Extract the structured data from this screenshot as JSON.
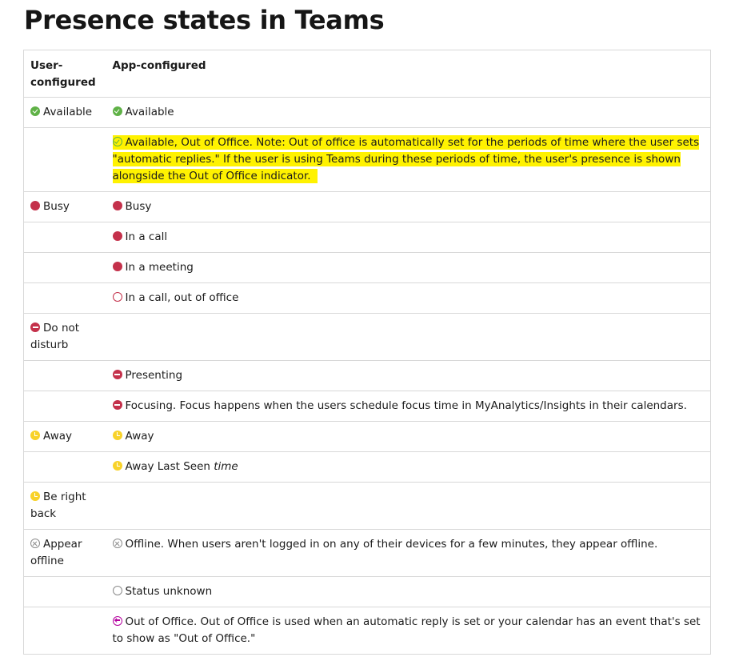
{
  "page_title": "Presence states in Teams",
  "headers": {
    "col1": "User-configured",
    "col2": "App-configured"
  },
  "rows": [
    {
      "user": {
        "icon": "available-icon",
        "text": "Available"
      },
      "app": {
        "icon": "available-icon",
        "text": "Available"
      }
    },
    {
      "user": null,
      "app": {
        "icon": "available-out-of-office-icon",
        "text": "Available, Out of Office. Note: Out of office is automatically set for the periods of time where the user sets \"automatic replies.\" If the user is using Teams during these periods of time, the user's presence is shown alongside the Out of Office indicator.",
        "highlighted": true
      }
    },
    {
      "user": {
        "icon": "busy-icon",
        "text": "Busy"
      },
      "app": {
        "icon": "busy-icon",
        "text": "Busy"
      }
    },
    {
      "user": null,
      "app": {
        "icon": "busy-icon",
        "text": "In a call"
      }
    },
    {
      "user": null,
      "app": {
        "icon": "busy-icon",
        "text": "In a meeting"
      }
    },
    {
      "user": null,
      "app": {
        "icon": "busy-out-of-office-icon",
        "text": "In a call, out of office"
      }
    },
    {
      "user": {
        "icon": "do-not-disturb-icon",
        "text": "Do not disturb"
      },
      "app": null
    },
    {
      "user": null,
      "app": {
        "icon": "do-not-disturb-icon",
        "text": "Presenting"
      }
    },
    {
      "user": null,
      "app": {
        "icon": "do-not-disturb-icon",
        "text": "Focusing. Focus happens when the users schedule focus time in MyAnalytics/Insights in their calendars."
      }
    },
    {
      "user": {
        "icon": "away-icon",
        "text": "Away"
      },
      "app": {
        "icon": "away-icon",
        "text": "Away"
      }
    },
    {
      "user": null,
      "app": {
        "icon": "away-icon",
        "text": "Away Last Seen",
        "suffix_italic": "time"
      }
    },
    {
      "user": {
        "icon": "away-icon",
        "text": "Be right back"
      },
      "app": null
    },
    {
      "user": {
        "icon": "offline-icon",
        "text": "Appear offline"
      },
      "app": {
        "icon": "offline-icon",
        "text": "Offline. When users aren't logged in on any of their devices for a few minutes, they appear offline."
      }
    },
    {
      "user": null,
      "app": {
        "icon": "status-unknown-icon",
        "text": "Status unknown"
      }
    },
    {
      "user": null,
      "app": {
        "icon": "out-of-office-icon",
        "text": "Out of Office. Out of Office is used when an automatic reply is set or your calendar has an event that's set to show as \"Out of Office.\""
      }
    }
  ],
  "colors": {
    "available": "#5fb146",
    "busy": "#c4314b",
    "away": "#f8d22a",
    "offline": "#8a8a8a",
    "out_of_office": "#b4009e",
    "highlight": "#fff200"
  }
}
